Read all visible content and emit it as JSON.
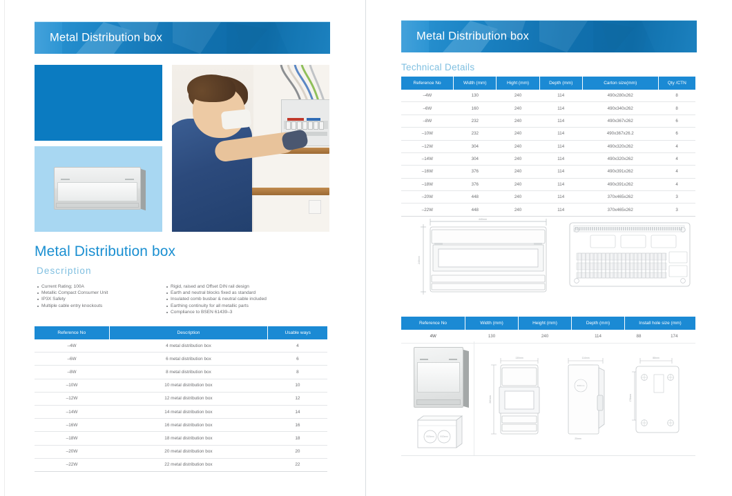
{
  "banner": {
    "title": "Metal Distribution box"
  },
  "left": {
    "product_title": "Metal Distribution box",
    "description_heading": "Description",
    "features_left": [
      "Current Rating; 100A",
      "Metallic Compact Consumer Unit",
      "IP3X Safety",
      "Multiple cable entry knockouts"
    ],
    "features_right": [
      "Rigid, raised and Offset DIN rail design",
      "Earth and neutral blocks fixed as standard",
      "Insulated comb busbar & neutral cable included",
      "Earthing continuity for all metallic parts",
      "Compliance to BSEN 61439–3"
    ],
    "table": {
      "headers": [
        "Reference  No",
        "Description",
        "Usable ways"
      ],
      "rows": [
        [
          "–4W",
          "4 metal distribution box",
          "4"
        ],
        [
          "–6W",
          "6 metal distribution box",
          "6"
        ],
        [
          "–8W",
          "8 metal distribution box",
          "8"
        ],
        [
          "–10W",
          "10 metal distribution box",
          "10"
        ],
        [
          "–12W",
          "12 metal distribution box",
          "12"
        ],
        [
          "–14W",
          "14 metal distribution box",
          "14"
        ],
        [
          "–16W",
          "16 metal distribution box",
          "16"
        ],
        [
          "–18W",
          "18 metal distribution box",
          "18"
        ],
        [
          "–20W",
          "20 metal distribution box",
          "20"
        ],
        [
          "–22W",
          "22 metal distribution box",
          "22"
        ]
      ]
    }
  },
  "right": {
    "technical_heading": "Technical Details",
    "tech_table": {
      "headers": [
        "Reference  No",
        "Width (mm)",
        "Hight (mm)",
        "Depth (mm)",
        "Carton size(mm)",
        "Qty /CTN"
      ],
      "rows": [
        [
          "–4W",
          "130",
          "240",
          "114",
          "490x280x262",
          "8"
        ],
        [
          "–6W",
          "160",
          "240",
          "114",
          "490x340x262",
          "8"
        ],
        [
          "–8W",
          "232",
          "240",
          "114",
          "490x367x262",
          "6"
        ],
        [
          "–10W",
          "232",
          "240",
          "114",
          "490x367x26.2",
          "6"
        ],
        [
          "–12W",
          "304",
          "240",
          "114",
          "490x320x262",
          "4"
        ],
        [
          "–14W",
          "304",
          "240",
          "114",
          "490x320x262",
          "4"
        ],
        [
          "–16W",
          "376",
          "240",
          "114",
          "490x391x262",
          "4"
        ],
        [
          "–18W",
          "376",
          "240",
          "114",
          "490x391x262",
          "4"
        ],
        [
          "–20W",
          "448",
          "240",
          "114",
          "370x465x262",
          "3"
        ],
        [
          "–22W",
          "448",
          "240",
          "114",
          "370x465x262",
          "3"
        ]
      ]
    },
    "install_table": {
      "headers": [
        "Reference  No",
        "Width (mm)",
        "Height (mm)",
        "Depth (mm)",
        "Install hole size (mm)"
      ],
      "row": [
        "4W",
        "130",
        "240",
        "114",
        "88",
        "174"
      ]
    },
    "drawings": {
      "front_width_label": "440mm",
      "front_height_label": "240mm",
      "dim_130": "130mm",
      "dim_240": "240mm",
      "dim_114": "114mm",
      "dim_88": "88mm",
      "dim_174": "174mm",
      "dim_20": "20mm",
      "dim_knockout": "Φ20mm"
    }
  }
}
